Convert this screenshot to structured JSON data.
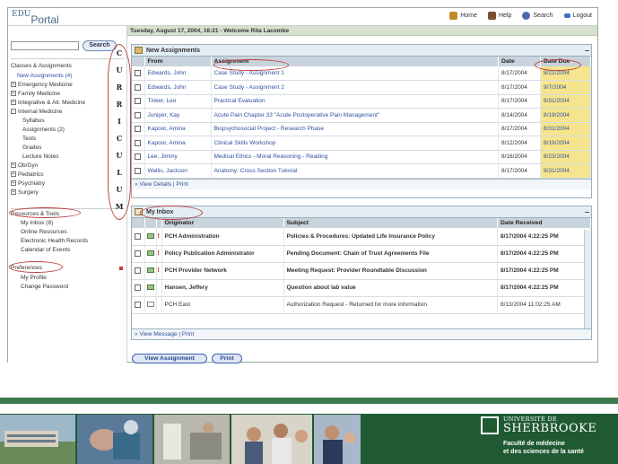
{
  "header": {
    "logo_sup": "EDU",
    "logo_main": "Portal",
    "links": [
      {
        "label": "Home",
        "icon": "home-icon",
        "color": "#c08a2a"
      },
      {
        "label": "Help",
        "icon": "help-icon",
        "color": "#7a5030"
      },
      {
        "label": "Search",
        "icon": "search-icon",
        "color": "#4a6ab0"
      },
      {
        "label": "Logout",
        "icon": "logout-icon",
        "color": "#3a70c0"
      }
    ],
    "welcome": "Tuesday, August 17, 2004, 16:21 - Welcome Rita Lacombe"
  },
  "sidebar": {
    "search_button": "Search",
    "classes_title": "Classes & Assignments",
    "classes": [
      {
        "label": "New Assignments (4)",
        "link": true
      },
      {
        "label": "Emergency Medicine",
        "expand": true
      },
      {
        "label": "Family Medicine",
        "expand": true
      },
      {
        "label": "Integrative & Alt. Medicine",
        "expand": true
      },
      {
        "label": "Internal Medicine",
        "expand": true
      },
      {
        "label": "Syllabus"
      },
      {
        "label": "Assignments (2)"
      },
      {
        "label": "Tests"
      },
      {
        "label": "Grades"
      },
      {
        "label": "Lecture Notes"
      },
      {
        "label": "Ob/Gyn",
        "expand": true
      },
      {
        "label": "Pediatrics",
        "expand": true
      },
      {
        "label": "Psychiatry",
        "expand": true
      },
      {
        "label": "Surgery",
        "expand": true
      }
    ],
    "curriculum_letters": [
      "C",
      "U",
      "R",
      "R",
      "I",
      "C",
      "U",
      "L",
      "U",
      "M"
    ],
    "resources_title": "Resources & Tools",
    "resources": [
      "My Inbox (8)",
      "Online Resources",
      "Electronic Health Records",
      "Calendar of Events"
    ],
    "preferences_title": "Preferences",
    "preferences": [
      "My Profile",
      "Change Password"
    ]
  },
  "assignments": {
    "title": "New Assignments",
    "columns": [
      "From",
      "Assignment",
      "Date",
      "Date Due"
    ],
    "rows": [
      [
        "Edwards, John",
        "Case Study - Assignment 1",
        "8/17/2004",
        "8/21/2004"
      ],
      [
        "Edwards, John",
        "Case Study - Assignment 2",
        "8/17/2004",
        "9/7/2004"
      ],
      [
        "Tinker, Leo",
        "Practical Evaluation",
        "8/17/2004",
        "8/31/2004"
      ],
      [
        "Juniper, Kay",
        "Acute Pain Chapter 33 \"Acute Postoperative Pain Management\"",
        "8/14/2004",
        "8/19/2004"
      ],
      [
        "Kapoor, Amina",
        "Biopsychosocial Project - Research Phase",
        "8/17/2004",
        "8/31/2004"
      ],
      [
        "Kapoor, Amina",
        "Clinical Skills Workshop",
        "8/12/2004",
        "8/19/2004"
      ],
      [
        "Lee, Jimmy",
        "Medical Ethics - Moral Reasoning - Reading",
        "8/16/2004",
        "8/23/2004"
      ],
      [
        "Wallis, Jackson",
        "Anatomy: Cross Section Tutorial",
        "8/17/2004",
        "8/31/2004"
      ]
    ],
    "footer_view": "» View Details",
    "footer_sep": "|",
    "footer_print": "Print"
  },
  "inbox": {
    "title": "My Inbox",
    "columns": [
      "Originator",
      "Subject",
      "Date Received"
    ],
    "rows": [
      {
        "originator": "PCH Administration",
        "subject": "Policies & Procedures: Updated Life Insurance Policy",
        "date": "8/17/2004 4:22:25 PM",
        "urgent": "!",
        "unread": true
      },
      {
        "originator": "Policy Publication Administrator",
        "subject": "Pending Document: Chain of Trust Agreements File",
        "date": "8/17/2004 4:22:25 PM",
        "urgent": "!",
        "unread": true
      },
      {
        "originator": "PCH Provider Network",
        "subject": "Meeting Request: Provider Roundtable Discussion",
        "date": "8/17/2004 4:22:25 PM",
        "urgent": "!",
        "unread": true
      },
      {
        "originator": "Hansen, Jeffery",
        "subject": "Question about lab value",
        "date": "8/17/2004 4:22:25 PM",
        "urgent": "",
        "unread": true
      },
      {
        "originator": "PCH East",
        "subject": "Authorization Request - Returned for more information",
        "date": "8/13/2004 11:02:25 AM",
        "urgent": "",
        "unread": false
      }
    ],
    "footer_view": "» View Message",
    "footer_sep": "|",
    "footer_print": "Print"
  },
  "buttons": {
    "view_assignment": "View Assignment",
    "print": "Print"
  },
  "university": {
    "line1": "UNIVERSITÉ DE",
    "line2": "SHERBROOKE",
    "line3": "Faculté de médecine",
    "line4": "et des sciences de la santé"
  },
  "colors": {
    "banner": "#1f5a32",
    "highlight_due": "#f6e58c",
    "annotation": "#c04040"
  }
}
